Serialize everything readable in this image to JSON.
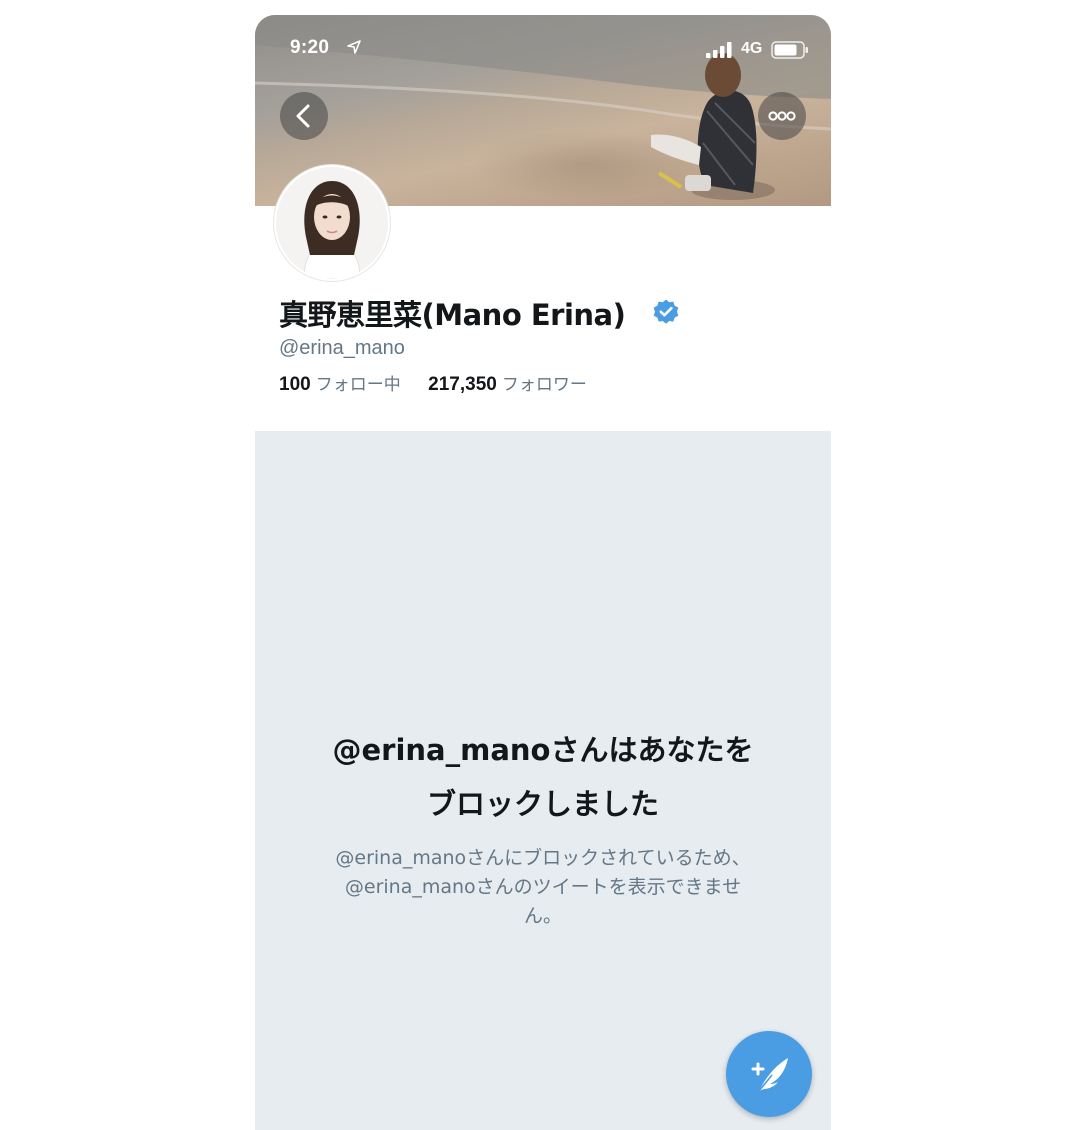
{
  "status_bar": {
    "time": "9:20",
    "network": "4G",
    "location_icon": "location-arrow-icon",
    "signal_icon": "cellular-signal-icon",
    "battery_icon": "battery-icon"
  },
  "header": {
    "back_icon": "chevron-left-icon",
    "more_icon": "more-horizontal-icon"
  },
  "profile": {
    "display_name": "真野恵里菜(Mano Erina)",
    "verified": true,
    "handle": "@erina_mano",
    "following_count": "100",
    "following_label": "フォロー中",
    "followers_count": "217,350",
    "followers_label": "フォロワー"
  },
  "blocked_notice": {
    "title_line1": "@erina_manoさんはあなたを",
    "title_line2": "ブロックしました",
    "desc_line1": "@erina_manoさんにブロックされているため、",
    "desc_line2": "@erina_manoさんのツイートを表示できませ",
    "desc_line3": "ん。"
  },
  "compose_button": {
    "icon": "compose-tweet-icon"
  },
  "colors": {
    "accent": "#1da1f2",
    "fab": "#4a9de2",
    "text_primary": "#14171a",
    "text_secondary": "#657786",
    "blocked_background": "#e6ecf0"
  }
}
